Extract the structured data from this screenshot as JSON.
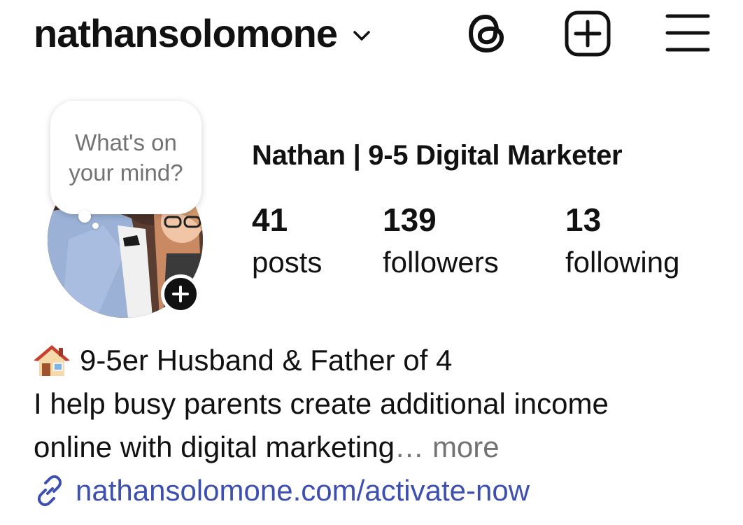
{
  "header": {
    "username": "nathansolomone",
    "icons": [
      "chevron-down-icon",
      "threads-icon",
      "add-post-icon",
      "menu-icon"
    ]
  },
  "note": {
    "text": "What's on your mind?"
  },
  "profile": {
    "display_name": "Nathan | 9-5 Digital Marketer",
    "stats": {
      "posts": {
        "count": "41",
        "label": "posts"
      },
      "followers": {
        "count": "139",
        "label": "followers"
      },
      "following": {
        "count": "13",
        "label": "following"
      }
    }
  },
  "bio": {
    "line1": "9-5er Husband & Father of 4",
    "line2": "I help busy parents create additional income",
    "line3": "online with digital marketing",
    "ellipsis": "…",
    "more": "more",
    "link": "nathansolomone.com/activate-now",
    "emoji": "house-icon"
  },
  "colors": {
    "link": "#3d4fb0",
    "muted": "#737373",
    "text": "#111111"
  }
}
